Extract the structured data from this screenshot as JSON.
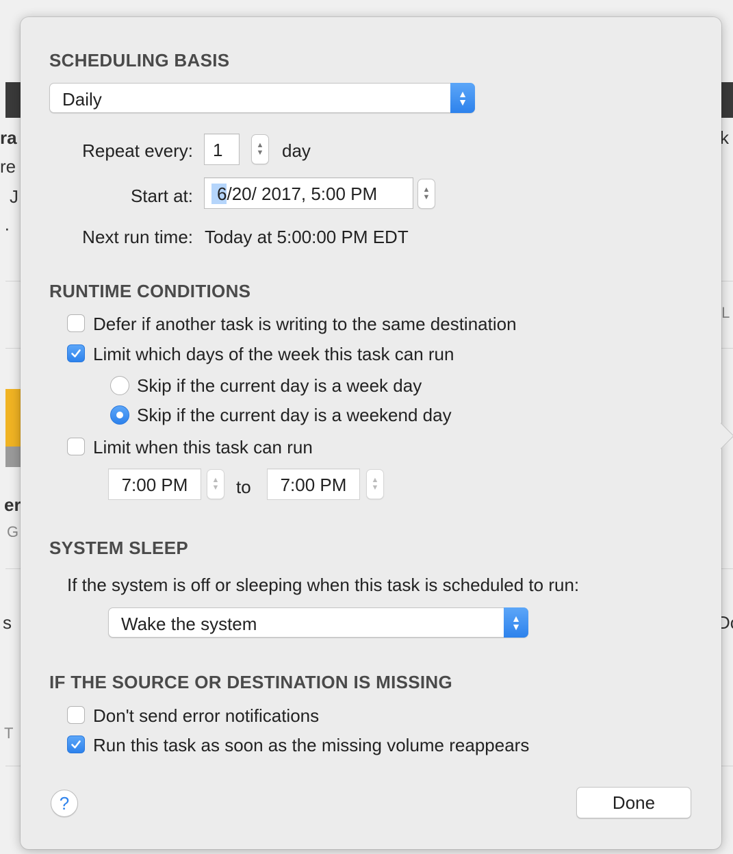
{
  "background": {
    "fragments": [
      "ra",
      "re",
      "J",
      "·",
      "IL",
      "k",
      "er",
      "G",
      "s",
      "Do",
      "T"
    ]
  },
  "scheduling": {
    "title": "SCHEDULING BASIS",
    "basis": "Daily",
    "repeat_label": "Repeat every:",
    "repeat_value": "1",
    "repeat_unit": "day",
    "start_label": "Start at:",
    "start_date_selected": "6",
    "start_date_rest": "/20/ 2017,   5:00 PM",
    "next_run_label": "Next run time:",
    "next_run_value": "Today at 5:00:00 PM EDT"
  },
  "runtime": {
    "title": "RUNTIME CONDITIONS",
    "defer_label": "Defer if another task is writing to the same destination",
    "defer_checked": false,
    "limit_days_label": "Limit which days of the week this task can run",
    "limit_days_checked": true,
    "skip_weekday_label": "Skip if the current day is a week day",
    "skip_weekday_selected": false,
    "skip_weekend_label": "Skip if the current day is a weekend day",
    "skip_weekend_selected": true,
    "limit_time_label": "Limit when this task can run",
    "limit_time_checked": false,
    "time_from": "7:00 PM",
    "time_to_label": "to",
    "time_to": "7:00 PM"
  },
  "sleep": {
    "title": "SYSTEM SLEEP",
    "prompt": "If the system is off or sleeping when this task is scheduled to run:",
    "action": "Wake the system"
  },
  "missing": {
    "title": "IF THE SOURCE OR DESTINATION IS MISSING",
    "no_notify_label": "Don't send error notifications",
    "no_notify_checked": false,
    "run_on_reappear_label": "Run this task as soon as the missing volume reappears",
    "run_on_reappear_checked": true
  },
  "footer": {
    "help_glyph": "?",
    "done_label": "Done"
  },
  "colors": {
    "accent": "#2d82ec",
    "panel": "#ececec"
  }
}
